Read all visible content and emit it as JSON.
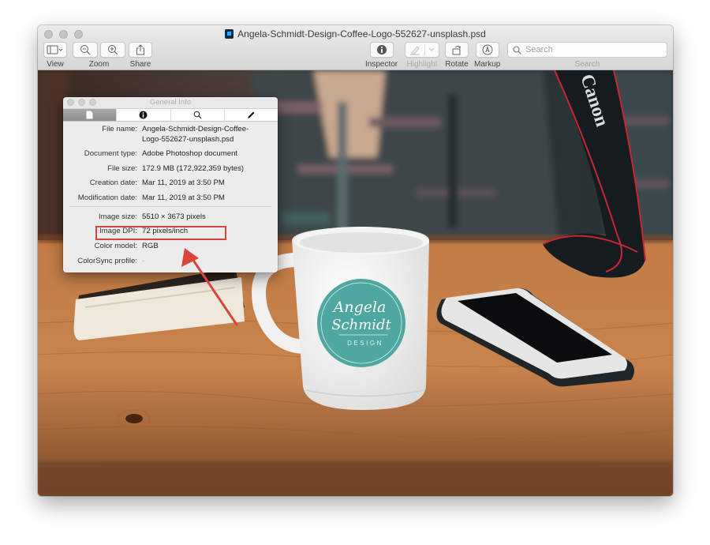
{
  "window": {
    "title": "Angela-Schmidt-Design-Coffee-Logo-552627-unsplash.psd",
    "file_icon": "photoshop-file-icon"
  },
  "toolbar": {
    "view_label": "View",
    "zoom_label": "Zoom",
    "share_label": "Share",
    "inspector_label": "Inspector",
    "highlight_label": "Highlight",
    "rotate_label": "Rotate",
    "markup_label": "Markup",
    "search_label": "Search",
    "search_placeholder": "Search",
    "search_value": ""
  },
  "info_panel": {
    "title": "General Info",
    "tabs": [
      {
        "icon": "document-icon",
        "active": true
      },
      {
        "icon": "info-icon",
        "active": false
      },
      {
        "icon": "magnifier-icon",
        "active": false
      },
      {
        "icon": "pencil-icon",
        "active": false
      }
    ],
    "rows": [
      {
        "label": "File name:",
        "value_line1": "Angela-Schmidt-Design-Coffee-",
        "value_line2": "Logo-552627-unsplash.psd"
      },
      {
        "label": "Document type:",
        "value": "Adobe Photoshop document"
      },
      {
        "label": "File size:",
        "value": "172.9 MB (172,922,359 bytes)"
      },
      {
        "label": "Creation date:",
        "value": "Mar 11, 2019 at 3:50 PM"
      },
      {
        "label": "Modification date:",
        "value": "Mar 11, 2019 at 3:50 PM"
      },
      {
        "label": "Image size:",
        "value": "5510 × 3673 pixels"
      },
      {
        "label": "Image DPI:",
        "value": "72 pixels/inch"
      },
      {
        "label": "Color model:",
        "value": "RGB"
      },
      {
        "label": "ColorSync profile:",
        "value": "-"
      }
    ]
  },
  "photo": {
    "mug_logo_line1": "Angela",
    "mug_logo_line2": "Schmidt",
    "mug_logo_line3": "DESIGN",
    "strap_text": "Canon"
  },
  "annotation": {
    "color": "#d9453b",
    "highlighted_field": "Image DPI"
  }
}
